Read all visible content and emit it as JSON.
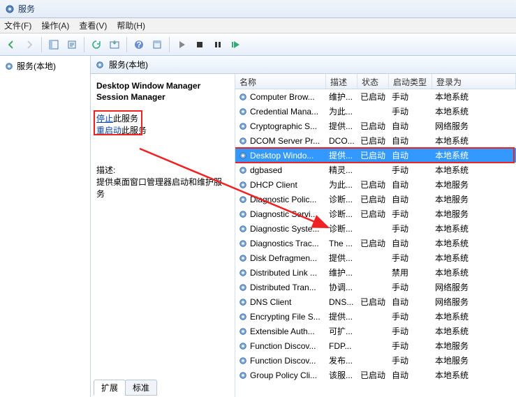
{
  "window": {
    "title": "服务"
  },
  "menus": {
    "file": "文件(F)",
    "action": "操作(A)",
    "view": "查看(V)",
    "help": "帮助(H)"
  },
  "left": {
    "root": "服务(本地)"
  },
  "crumb": {
    "text": "服务(本地)"
  },
  "detail": {
    "name_line1": "Desktop Window Manager",
    "name_line2": "Session Manager",
    "stop_prefix": "停止",
    "stop_suffix": "此服务",
    "restart_prefix": "重启动",
    "restart_suffix": "此服务",
    "desc_label": "描述:",
    "desc_text": "提供桌面窗口管理器启动和维护服务"
  },
  "columns": {
    "name": "名称",
    "desc": "描述",
    "status": "状态",
    "startup": "启动类型",
    "logon": "登录为"
  },
  "services": [
    {
      "name": "Computer Brow...",
      "desc": "维护...",
      "status": "已启动",
      "startup": "手动",
      "logon": "本地系统"
    },
    {
      "name": "Credential Mana...",
      "desc": "为此...",
      "status": "",
      "startup": "手动",
      "logon": "本地系统"
    },
    {
      "name": "Cryptographic S...",
      "desc": "提供...",
      "status": "已启动",
      "startup": "自动",
      "logon": "网络服务"
    },
    {
      "name": "DCOM Server Pr...",
      "desc": "DCO...",
      "status": "已启动",
      "startup": "自动",
      "logon": "本地系统"
    },
    {
      "name": "Desktop Windo...",
      "desc": "提供...",
      "status": "已启动",
      "startup": "自动",
      "logon": "本地系统",
      "selected": true
    },
    {
      "name": "dgbased",
      "desc": "精灵...",
      "status": "",
      "startup": "手动",
      "logon": "本地系统"
    },
    {
      "name": "DHCP Client",
      "desc": "为此...",
      "status": "已启动",
      "startup": "自动",
      "logon": "本地服务"
    },
    {
      "name": "Diagnostic Polic...",
      "desc": "诊断...",
      "status": "已启动",
      "startup": "自动",
      "logon": "本地服务"
    },
    {
      "name": "Diagnostic Servi...",
      "desc": "诊断...",
      "status": "已启动",
      "startup": "手动",
      "logon": "本地服务"
    },
    {
      "name": "Diagnostic Syste...",
      "desc": "诊断...",
      "status": "",
      "startup": "手动",
      "logon": "本地系统"
    },
    {
      "name": "Diagnostics Trac...",
      "desc": "The ...",
      "status": "已启动",
      "startup": "自动",
      "logon": "本地系统"
    },
    {
      "name": "Disk Defragmen...",
      "desc": "提供...",
      "status": "",
      "startup": "手动",
      "logon": "本地系统"
    },
    {
      "name": "Distributed Link ...",
      "desc": "维护...",
      "status": "",
      "startup": "禁用",
      "logon": "本地系统"
    },
    {
      "name": "Distributed Tran...",
      "desc": "协调...",
      "status": "",
      "startup": "手动",
      "logon": "网络服务"
    },
    {
      "name": "DNS Client",
      "desc": "DNS...",
      "status": "已启动",
      "startup": "自动",
      "logon": "网络服务"
    },
    {
      "name": "Encrypting File S...",
      "desc": "提供...",
      "status": "",
      "startup": "手动",
      "logon": "本地系统"
    },
    {
      "name": "Extensible Auth...",
      "desc": "可扩...",
      "status": "",
      "startup": "手动",
      "logon": "本地系统"
    },
    {
      "name": "Function Discov...",
      "desc": "FDP...",
      "status": "",
      "startup": "手动",
      "logon": "本地服务"
    },
    {
      "name": "Function Discov...",
      "desc": "发布...",
      "status": "",
      "startup": "手动",
      "logon": "本地服务"
    },
    {
      "name": "Group Policy Cli...",
      "desc": "该服...",
      "status": "已启动",
      "startup": "自动",
      "logon": "本地系统"
    }
  ],
  "tabs": {
    "extended": "扩展",
    "standard": "标准"
  }
}
